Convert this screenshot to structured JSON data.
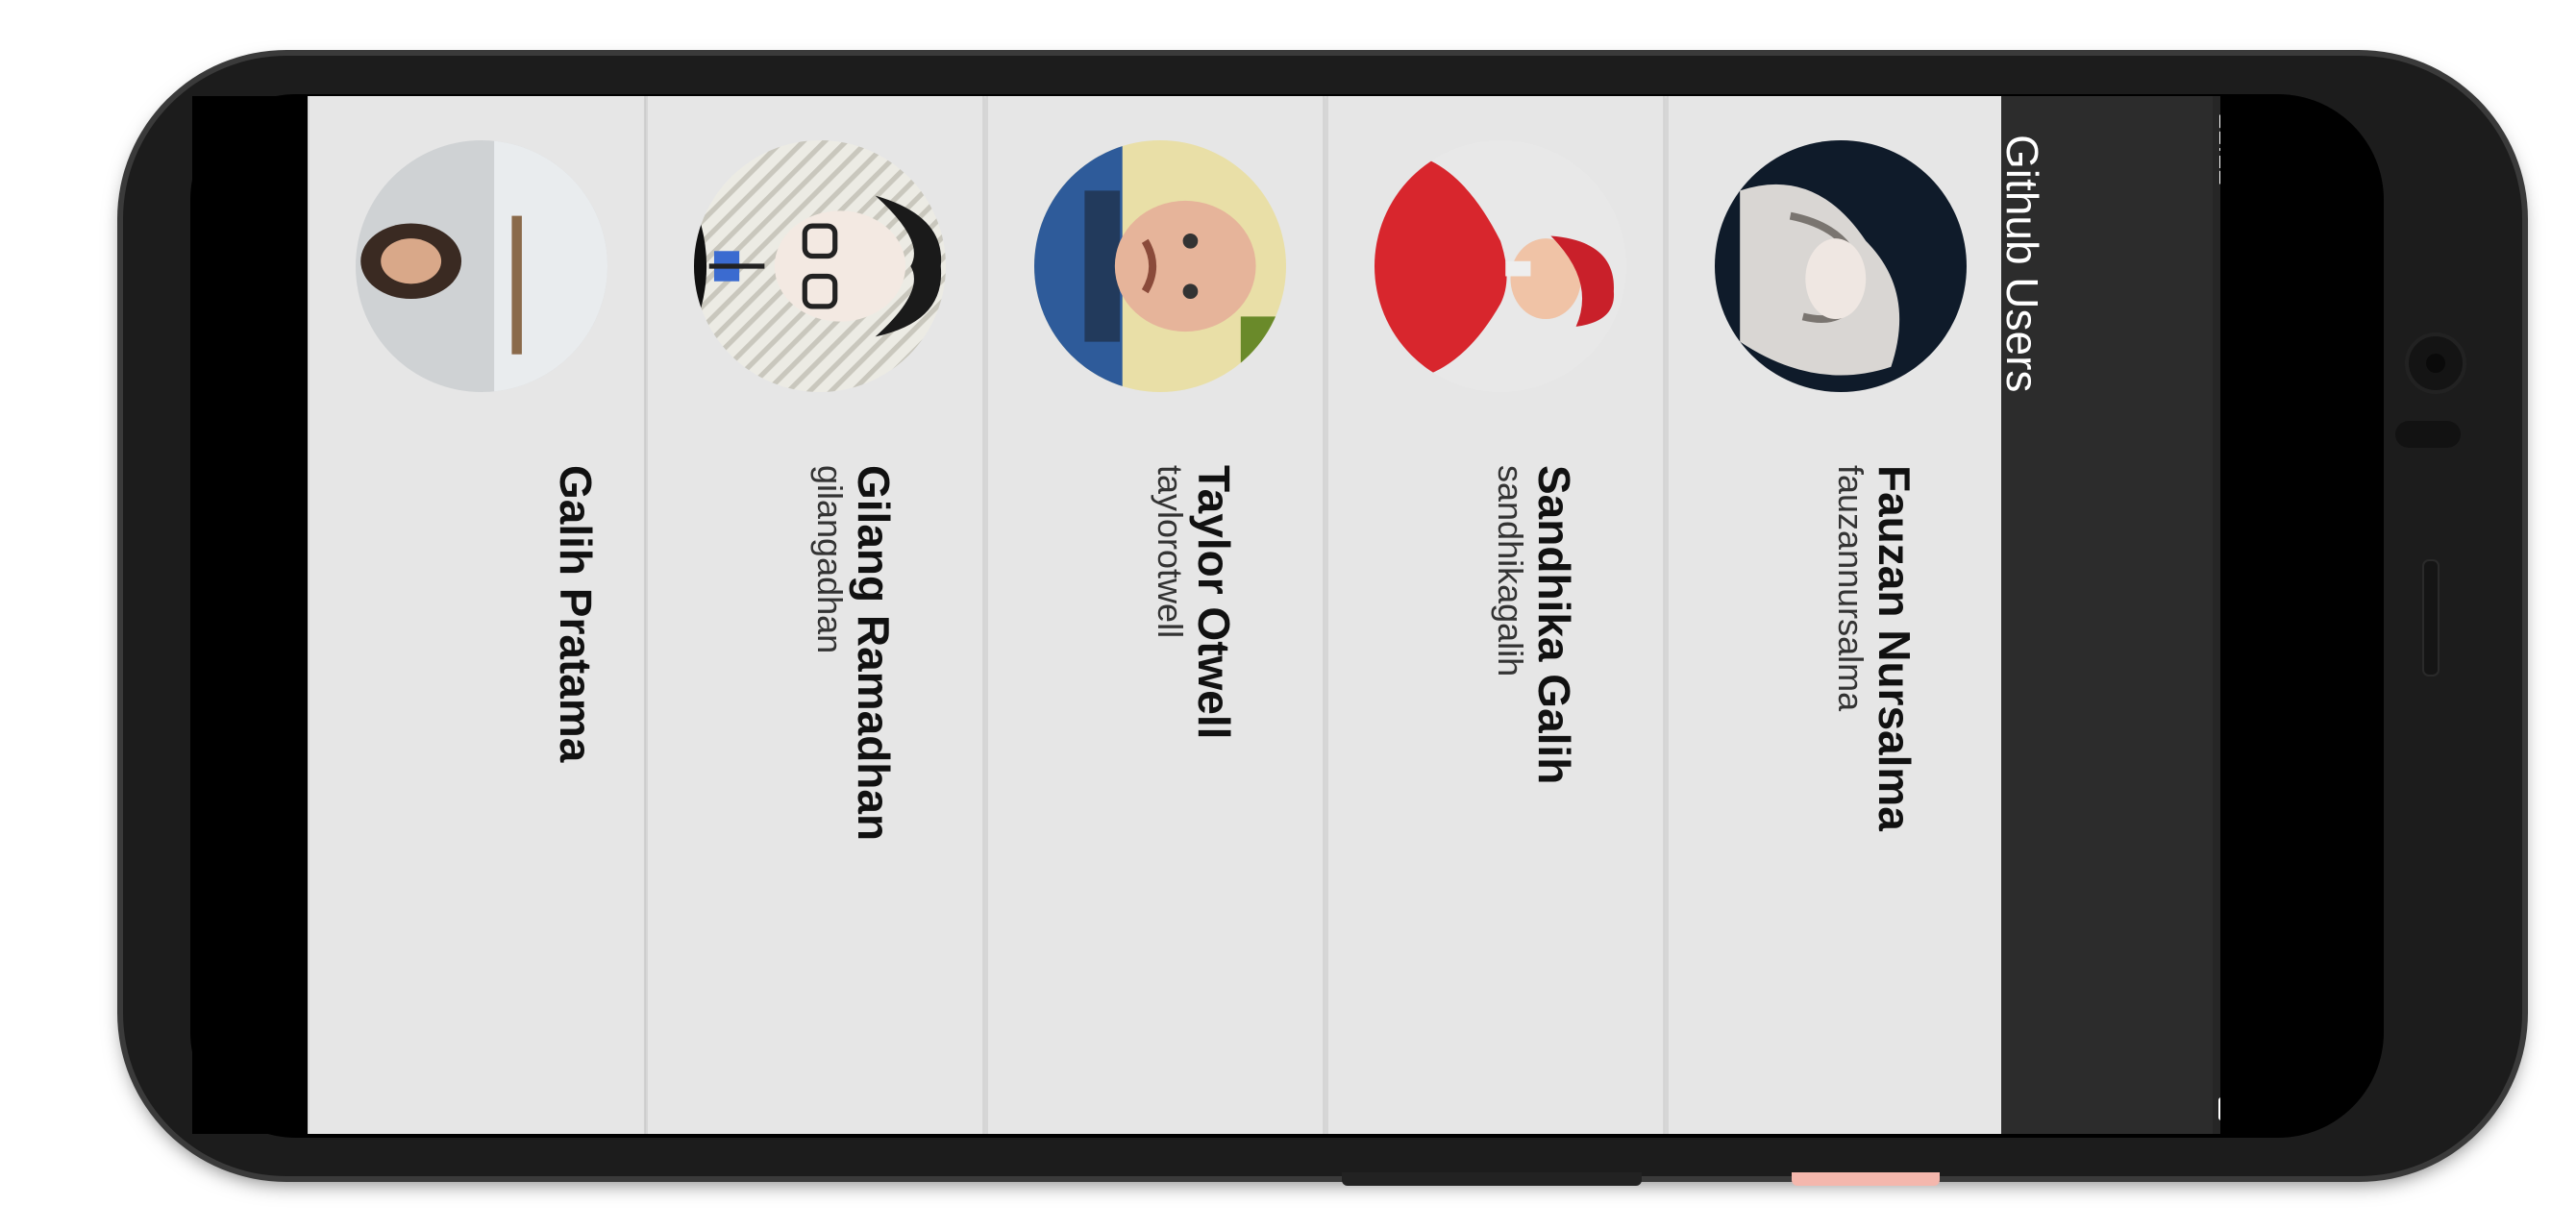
{
  "status_bar": {
    "time": "21.12"
  },
  "app_bar": {
    "title": "Github Users"
  },
  "users": [
    {
      "name": "Fauzan Nursalma",
      "username": "fauzannursalma"
    },
    {
      "name": "Sandhika Galih",
      "username": "sandhikagalih"
    },
    {
      "name": "Taylor Otwell",
      "username": "taylorotwell"
    },
    {
      "name": "Gilang Ramadhan",
      "username": "gilangadhan"
    },
    {
      "name": "Galih Pratama",
      "username": ""
    }
  ],
  "nav": {
    "back_icon": "back-triangle-icon",
    "home_icon": "home-circle-icon",
    "recent_icon": "recent-square-icon"
  },
  "colors": {
    "app_bar": "#2c2c2c",
    "card": "#e6e6e6"
  }
}
